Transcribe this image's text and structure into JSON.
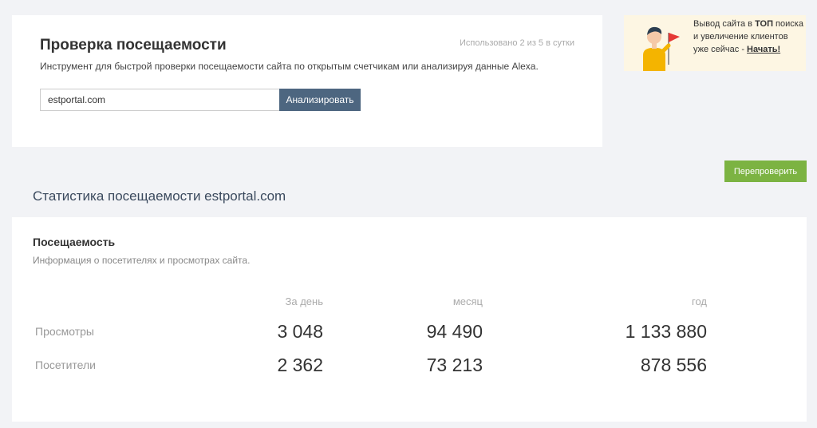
{
  "checker": {
    "title": "Проверка посещаемости",
    "usage": "Использовано 2 из 5 в сутки",
    "description": "Инструмент для быстрой проверки посещаемости сайта по открытым счетчикам или анализируя данные Alexa.",
    "input_value": "estportal.com",
    "analyze_label": "Анализировать"
  },
  "promo": {
    "line1_pre": "Вывод сайта в ",
    "line1_bold": "ТОП",
    "line2": " поиска и увеличение клиентов уже сейчас - ",
    "link": "Начать!",
    "icon": "person-with-flag-icon"
  },
  "recheck_label": "Перепроверить",
  "stats": {
    "heading": "Статистика посещаемости estportal.com",
    "section_title": "Посещаемость",
    "section_subtitle": "Информация о посетителях и просмотрах сайта.",
    "columns": [
      "За день",
      "месяц",
      "год"
    ],
    "rows": [
      {
        "label": "Просмотры",
        "values": [
          "3 048",
          "94 490",
          "1 133 880"
        ]
      },
      {
        "label": "Посетители",
        "values": [
          "2 362",
          "73 213",
          "878 556"
        ]
      }
    ]
  },
  "colors": {
    "analyze_button": "#4d6680",
    "recheck_button": "#7cb342",
    "promo_bg": "#fdf6e3",
    "page_bg": "#f2f3f6"
  }
}
